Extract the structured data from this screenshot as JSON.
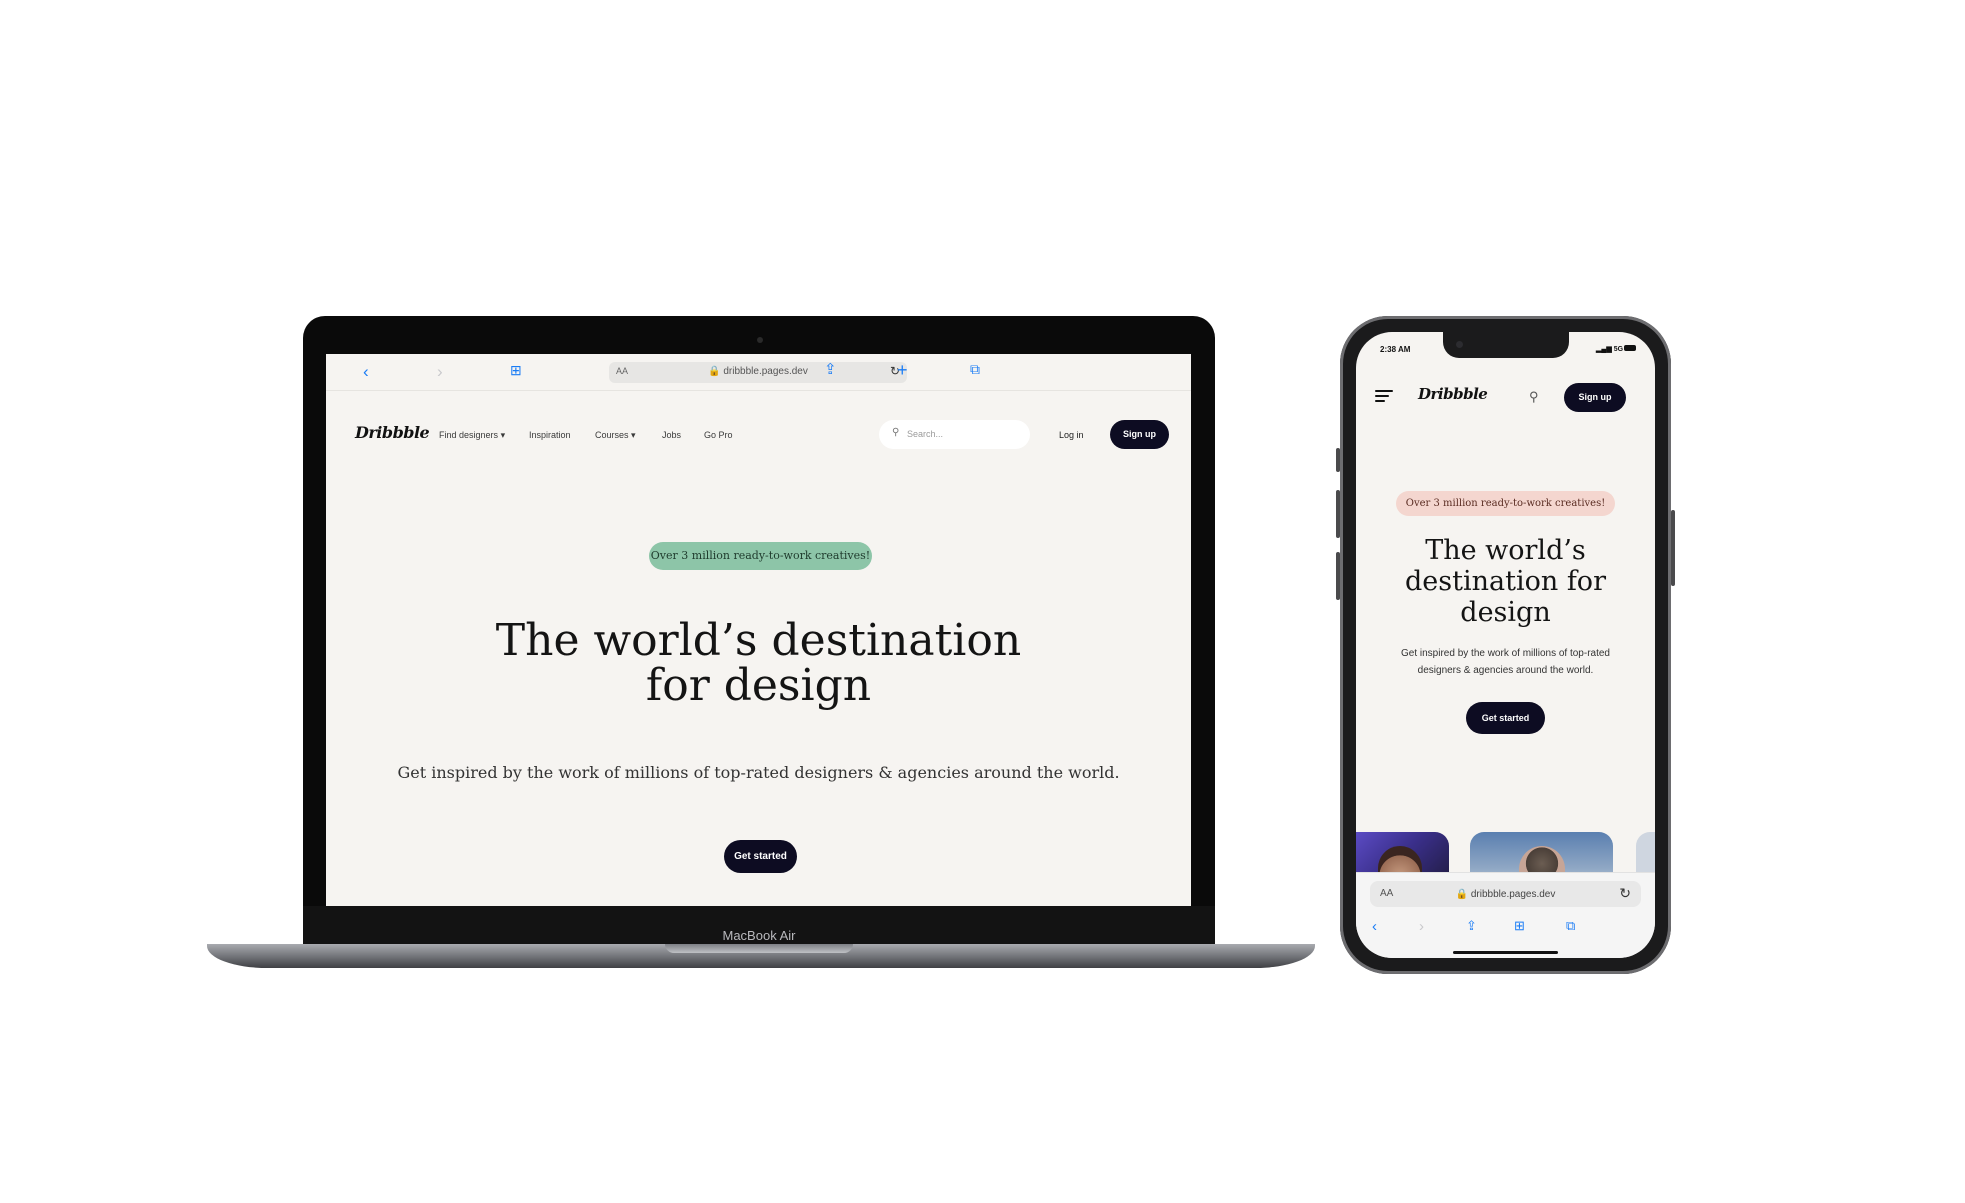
{
  "laptop": {
    "model_label": "MacBook Air",
    "browser": {
      "address_aa": "AA",
      "url": "dribbble.pages.dev",
      "icons": [
        "back-icon",
        "forward-icon",
        "bookmarks-icon",
        "reload-icon",
        "share-icon",
        "plus-icon",
        "tabs-icon"
      ]
    },
    "site": {
      "logo": "Dribbble",
      "nav": [
        "Find designers",
        "Inspiration",
        "Courses",
        "Jobs",
        "Go Pro"
      ],
      "search_placeholder": "Search...",
      "login": "Log in",
      "signup": "Sign up",
      "badge": "Over 3 million ready-to-work creatives!",
      "headline_line1": "The world’s destination",
      "headline_line2": "for design",
      "subtitle": "Get inspired by the work of millions of top-rated designers & agencies around the world.",
      "cta": "Get started"
    }
  },
  "phone": {
    "status": {
      "time": "2:38 AM",
      "network": "5G"
    },
    "site": {
      "logo": "Dribbble",
      "signup": "Sign up",
      "badge": "Over 3 million ready-to-work creatives!",
      "headline_line1": "The world’s",
      "headline_line2": "destination for",
      "headline_line3": "design",
      "subtitle_line1": "Get inspired by the work of millions of top-rated",
      "subtitle_line2": "designers & agencies around the world.",
      "cta": "Get started"
    },
    "browser": {
      "address_aa": "AA",
      "url": "dribbble.pages.dev"
    }
  },
  "colors": {
    "page_bg": "#f6f4f1",
    "button_dark": "#0d0c22",
    "laptop_badge": "#8dc5a8",
    "phone_badge": "#f4d6cf",
    "safari_blue": "#1a7cf5"
  }
}
